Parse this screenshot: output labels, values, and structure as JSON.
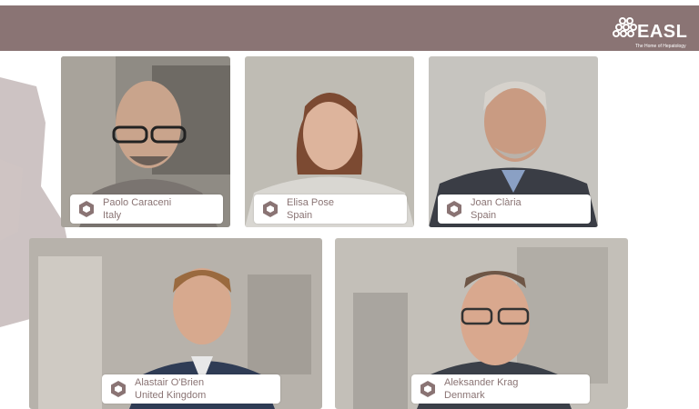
{
  "brand": {
    "logo_text": "EASL",
    "tagline": "The Home of Hepatology",
    "band_color": "#8a7474"
  },
  "participants": [
    {
      "name": "Paolo Caraceni",
      "country": "Italy"
    },
    {
      "name": "Elisa Pose",
      "country": "Spain"
    },
    {
      "name": "Joan Clària",
      "country": "Spain"
    },
    {
      "name": "Alastair O'Brien",
      "country": "United Kingdom"
    },
    {
      "name": "Aleksander Krag",
      "country": "Denmark"
    }
  ]
}
